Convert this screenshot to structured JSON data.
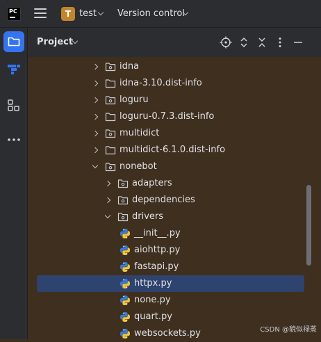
{
  "topbar": {
    "app_logo_text": "PC",
    "project_badge": "T",
    "project_name": "test",
    "vcs_label": "Version control"
  },
  "panel": {
    "title": "Project"
  },
  "tree": [
    {
      "label": "idna",
      "icon": "package-folder-icon",
      "expanded": false
    },
    {
      "label": "idna-3.10.dist-info",
      "icon": "folder-icon",
      "expanded": false
    },
    {
      "label": "loguru",
      "icon": "package-folder-icon",
      "expanded": false
    },
    {
      "label": "loguru-0.7.3.dist-info",
      "icon": "folder-icon",
      "expanded": false
    },
    {
      "label": "multidict",
      "icon": "package-folder-icon",
      "expanded": false
    },
    {
      "label": "multidict-6.1.0.dist-info",
      "icon": "folder-icon",
      "expanded": false
    },
    {
      "label": "nonebot",
      "icon": "package-folder-icon",
      "expanded": true
    },
    {
      "label": "adapters",
      "icon": "package-folder-icon",
      "expanded": false
    },
    {
      "label": "dependencies",
      "icon": "package-folder-icon",
      "expanded": false
    },
    {
      "label": "drivers",
      "icon": "package-folder-icon",
      "expanded": true
    },
    {
      "label": "__init__.py",
      "icon": "python-file-icon"
    },
    {
      "label": "aiohttp.py",
      "icon": "python-file-icon"
    },
    {
      "label": "fastapi.py",
      "icon": "python-file-icon"
    },
    {
      "label": "httpx.py",
      "icon": "python-file-icon",
      "selected": true
    },
    {
      "label": "none.py",
      "icon": "python-file-icon"
    },
    {
      "label": "quart.py",
      "icon": "python-file-icon"
    },
    {
      "label": "websockets.py",
      "icon": "python-file-icon"
    }
  ],
  "watermark": "CSDN @貌似禄蒸",
  "colors": {
    "accent": "#3574f0",
    "selection": "#2e436e",
    "badge": "#c0862e",
    "tree_background": "#3f2f1f"
  }
}
